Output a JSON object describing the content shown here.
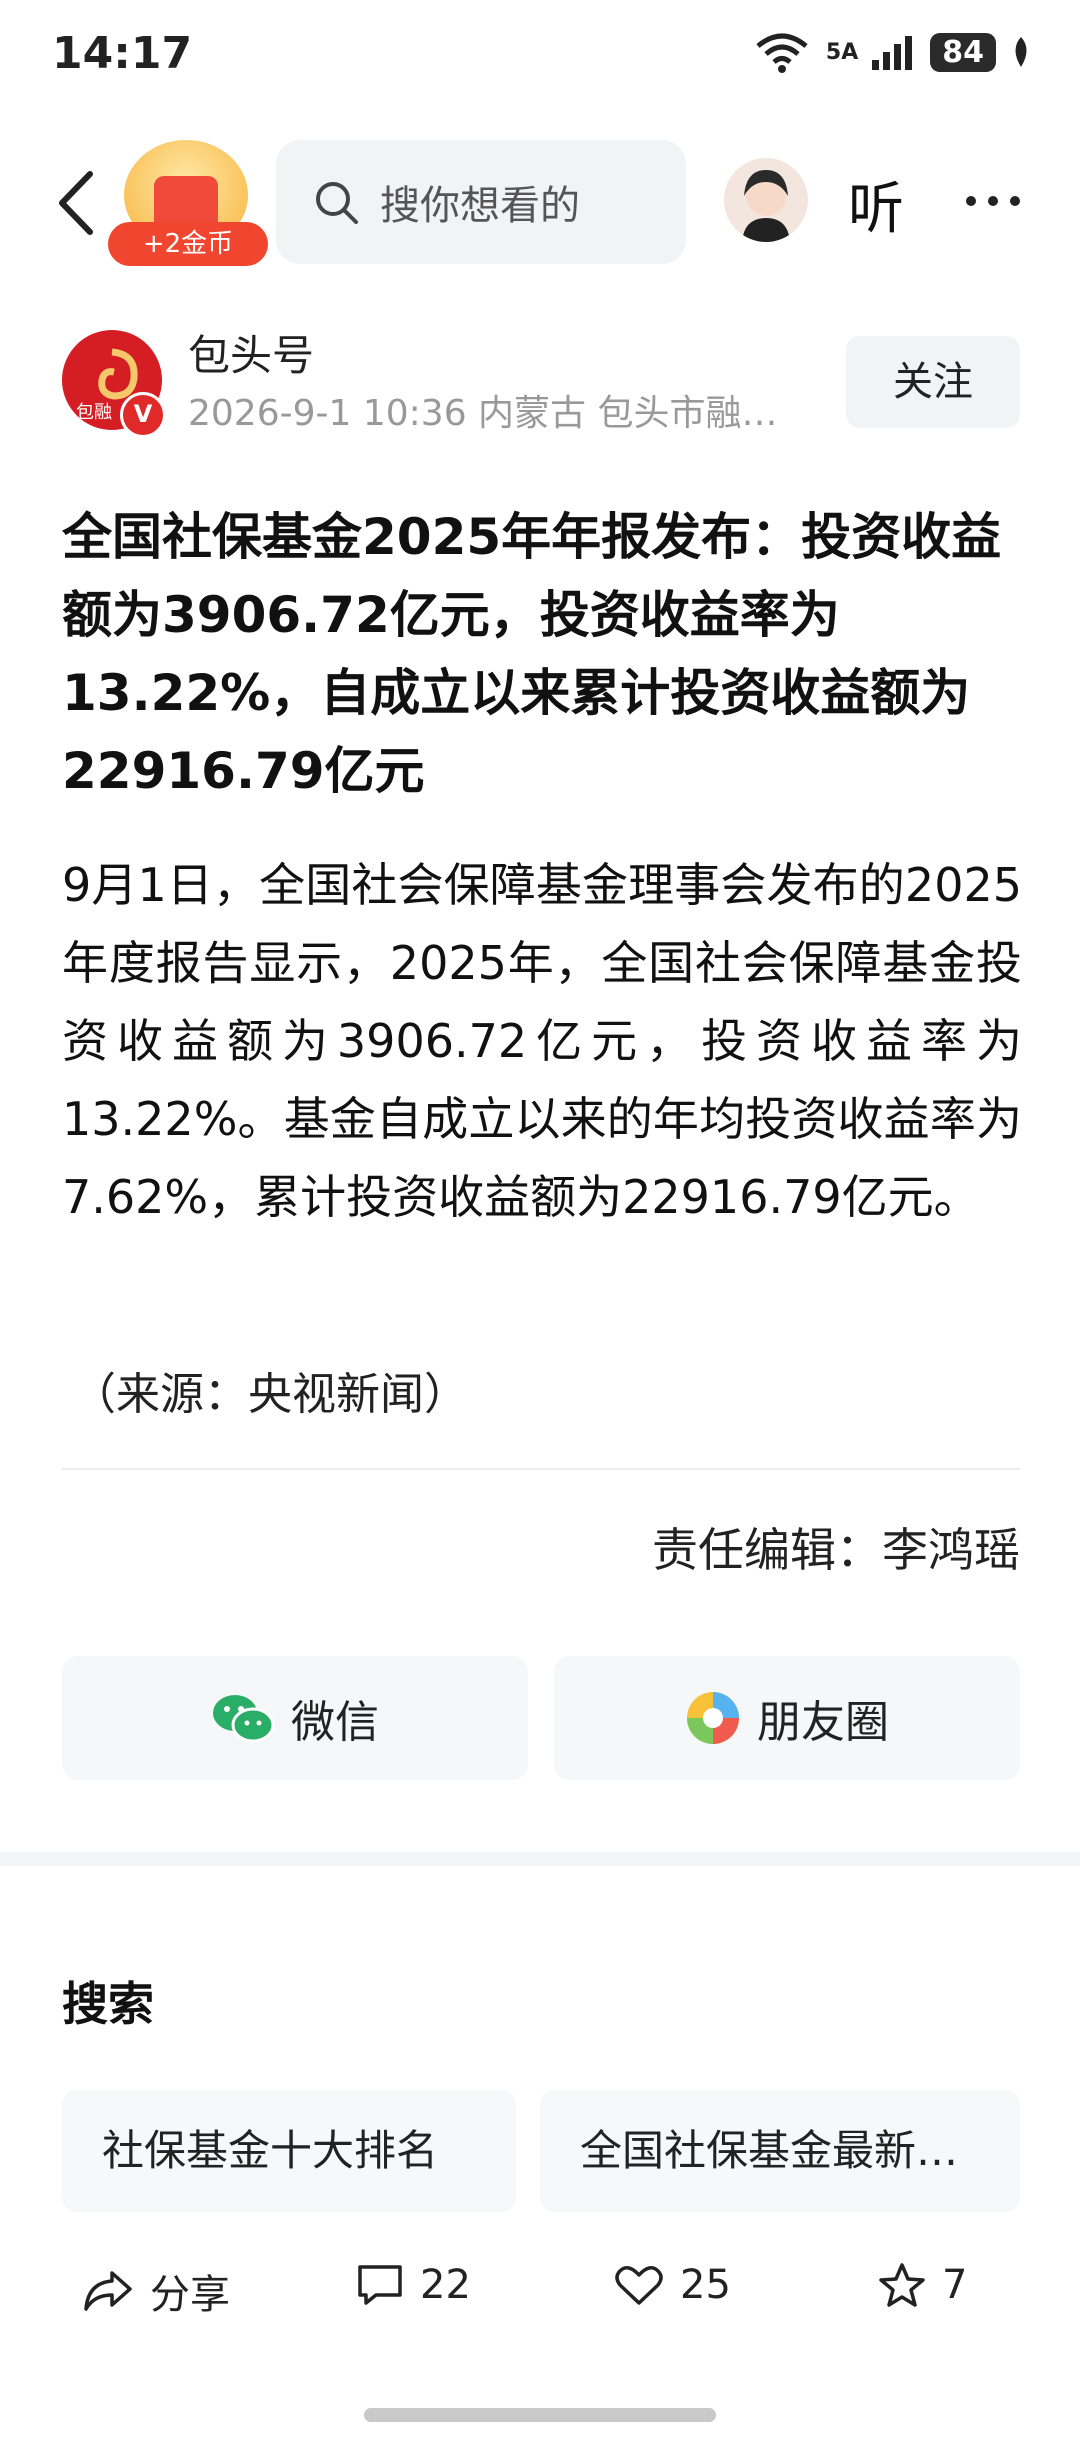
{
  "status_bar": {
    "time": "14:17",
    "battery": "84",
    "signal_label": "5A",
    "wifi_label": "6"
  },
  "header": {
    "coin_badge": "+2金币",
    "search_placeholder": "搜你想看的",
    "listen_label": "听"
  },
  "author": {
    "logo_text": "包融",
    "name": "包头号",
    "meta": "2026-9-1  10:36  内蒙古  包头市融…",
    "follow_label": "关注"
  },
  "article": {
    "headline": "全国社保基金2025年年报发布：投资收益额为3906.72亿元，投资收益率为13.22%，自成立以来累计投资收益额为22916.79亿元",
    "body": "9月1日，全国社会保障基金理事会发布的2025年度报告显示，2025年，全国社会保障基金投资收益额为3906.72亿元，投资收益率为13.22%。基金自成立以来的年均投资收益率为7.62%，累计投资收益额为22916.79亿元。",
    "source": "（来源：央视新闻）",
    "editor": "责任编辑：李鸿瑶"
  },
  "share": {
    "wechat_label": "微信",
    "moments_label": "朋友圈"
  },
  "search_section": {
    "heading": "搜索",
    "suggestions": [
      "社保基金十大排名",
      "全国社保基金最新…"
    ]
  },
  "actions": {
    "share_label": "分享",
    "comments": "22",
    "likes": "25",
    "favorites": "7"
  },
  "colors": {
    "accent_red": "#f0462f",
    "wechat_green": "#2aae67"
  }
}
